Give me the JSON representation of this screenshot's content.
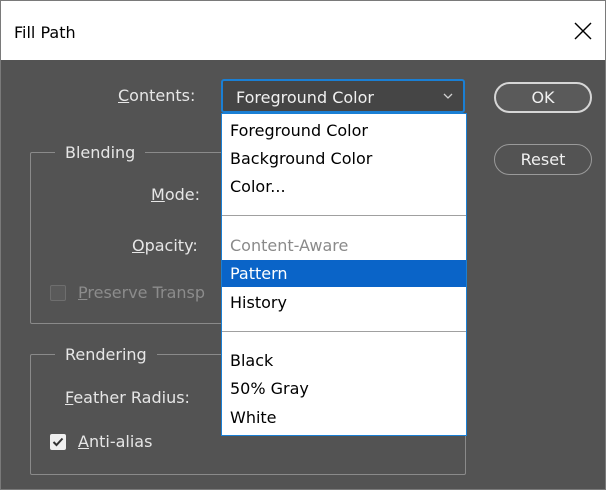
{
  "window": {
    "title": "Fill Path"
  },
  "contents": {
    "label": "Contents:",
    "label_accel": "C",
    "label_rest": "ontents:",
    "selected_value": "Foreground Color"
  },
  "buttons": {
    "ok": "OK",
    "reset": "Reset"
  },
  "blending": {
    "title": "Blending",
    "mode_accel": "M",
    "mode_rest": "ode:",
    "opacity_accel": "O",
    "opacity_rest": "pacity:",
    "preserve_accel": "P",
    "preserve_rest": "reserve Transp"
  },
  "rendering": {
    "title": "Rendering",
    "feather_accel": "F",
    "feather_rest": "eather Radius:",
    "antialias_accel": "A",
    "antialias_rest": "nti-alias",
    "antialias_checked": true
  },
  "dropdown_options": [
    {
      "label": "Foreground Color",
      "state": "normal"
    },
    {
      "label": "Background Color",
      "state": "normal"
    },
    {
      "label": "Color...",
      "state": "normal"
    },
    {
      "label": "Content-Aware",
      "state": "disabled"
    },
    {
      "label": "Pattern",
      "state": "highlighted"
    },
    {
      "label": "History",
      "state": "normal"
    },
    {
      "label": "Black",
      "state": "normal"
    },
    {
      "label": "50% Gray",
      "state": "normal"
    },
    {
      "label": "White",
      "state": "normal"
    }
  ],
  "colors": {
    "dialog_bg": "#535353",
    "accent_blue": "#1a7fd4",
    "highlight": "#0a64c8"
  },
  "icons": {
    "close": "close-icon",
    "chevron": "chevron-down-icon",
    "check": "checkmark-icon"
  }
}
